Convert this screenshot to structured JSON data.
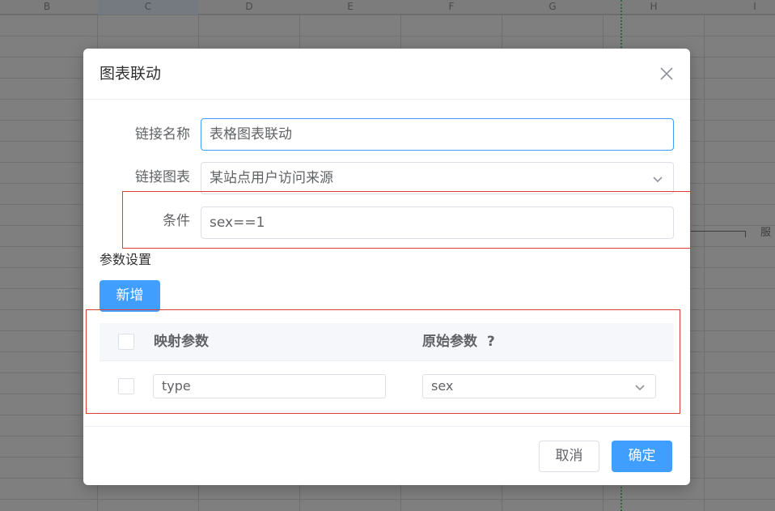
{
  "spreadsheet": {
    "columns": [
      "B",
      "C",
      "D",
      "E",
      "F",
      "G",
      "H",
      "I"
    ],
    "side_text": "服"
  },
  "dialog": {
    "title": "图表联动",
    "close_icon": "close-icon",
    "form": {
      "link_name_label": "链接名称",
      "link_name_value": "表格图表联动",
      "link_chart_label": "链接图表",
      "link_chart_value": "某站点用户访问来源",
      "condition_label": "条件",
      "condition_value": "sex==1"
    },
    "params": {
      "section_title": "参数设置",
      "add_label": "新增",
      "headers": [
        "映射参数",
        "原始参数"
      ],
      "help_mark": "?",
      "rows": [
        {
          "mapped": "type",
          "original": "sex"
        }
      ]
    },
    "footer": {
      "cancel_label": "取消",
      "ok_label": "确定"
    },
    "colors": {
      "primary": "#409eff",
      "annotation_red": "#e03b3b"
    }
  }
}
